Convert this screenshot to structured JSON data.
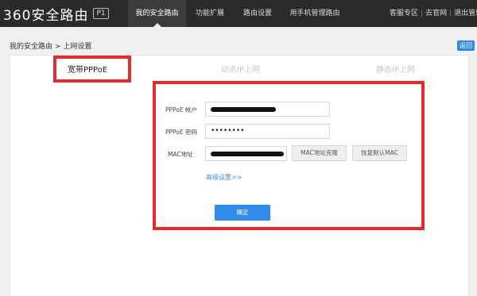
{
  "header": {
    "logo_text": "360安全路由",
    "model_badge": "P1",
    "tabs": [
      {
        "label": "我的安全路由",
        "active": true
      },
      {
        "label": "功能扩展",
        "active": false
      },
      {
        "label": "路由设置",
        "active": false
      },
      {
        "label": "用手机管理路由",
        "active": false
      }
    ],
    "links": [
      "客服专区",
      "去官网",
      "退出管理"
    ]
  },
  "breadcrumb": {
    "parent": "我的安全路由",
    "separator": ">",
    "current": "上网设置"
  },
  "back_label": "返回",
  "connection_tabs": [
    {
      "label": "宽带PPPoE",
      "active": true
    },
    {
      "label": "动态IP上网",
      "active": false
    },
    {
      "label": "静态IP上网",
      "active": false
    }
  ],
  "form": {
    "account_label": "PPPoE 帐户",
    "password_label": "PPPoE 密码",
    "password_value": "••••••••",
    "mac_label": "MAC地址",
    "clone_mac_button": "MAC地址克隆",
    "restore_mac_button": "恢复默认MAC",
    "advanced_link": "高级设置>>",
    "confirm_button": "确定"
  },
  "colors": {
    "topbar": "#2a2a2a",
    "highlight": "#e52b2b",
    "primary_button": "#2f8ceb",
    "link": "#3a8fd9"
  }
}
